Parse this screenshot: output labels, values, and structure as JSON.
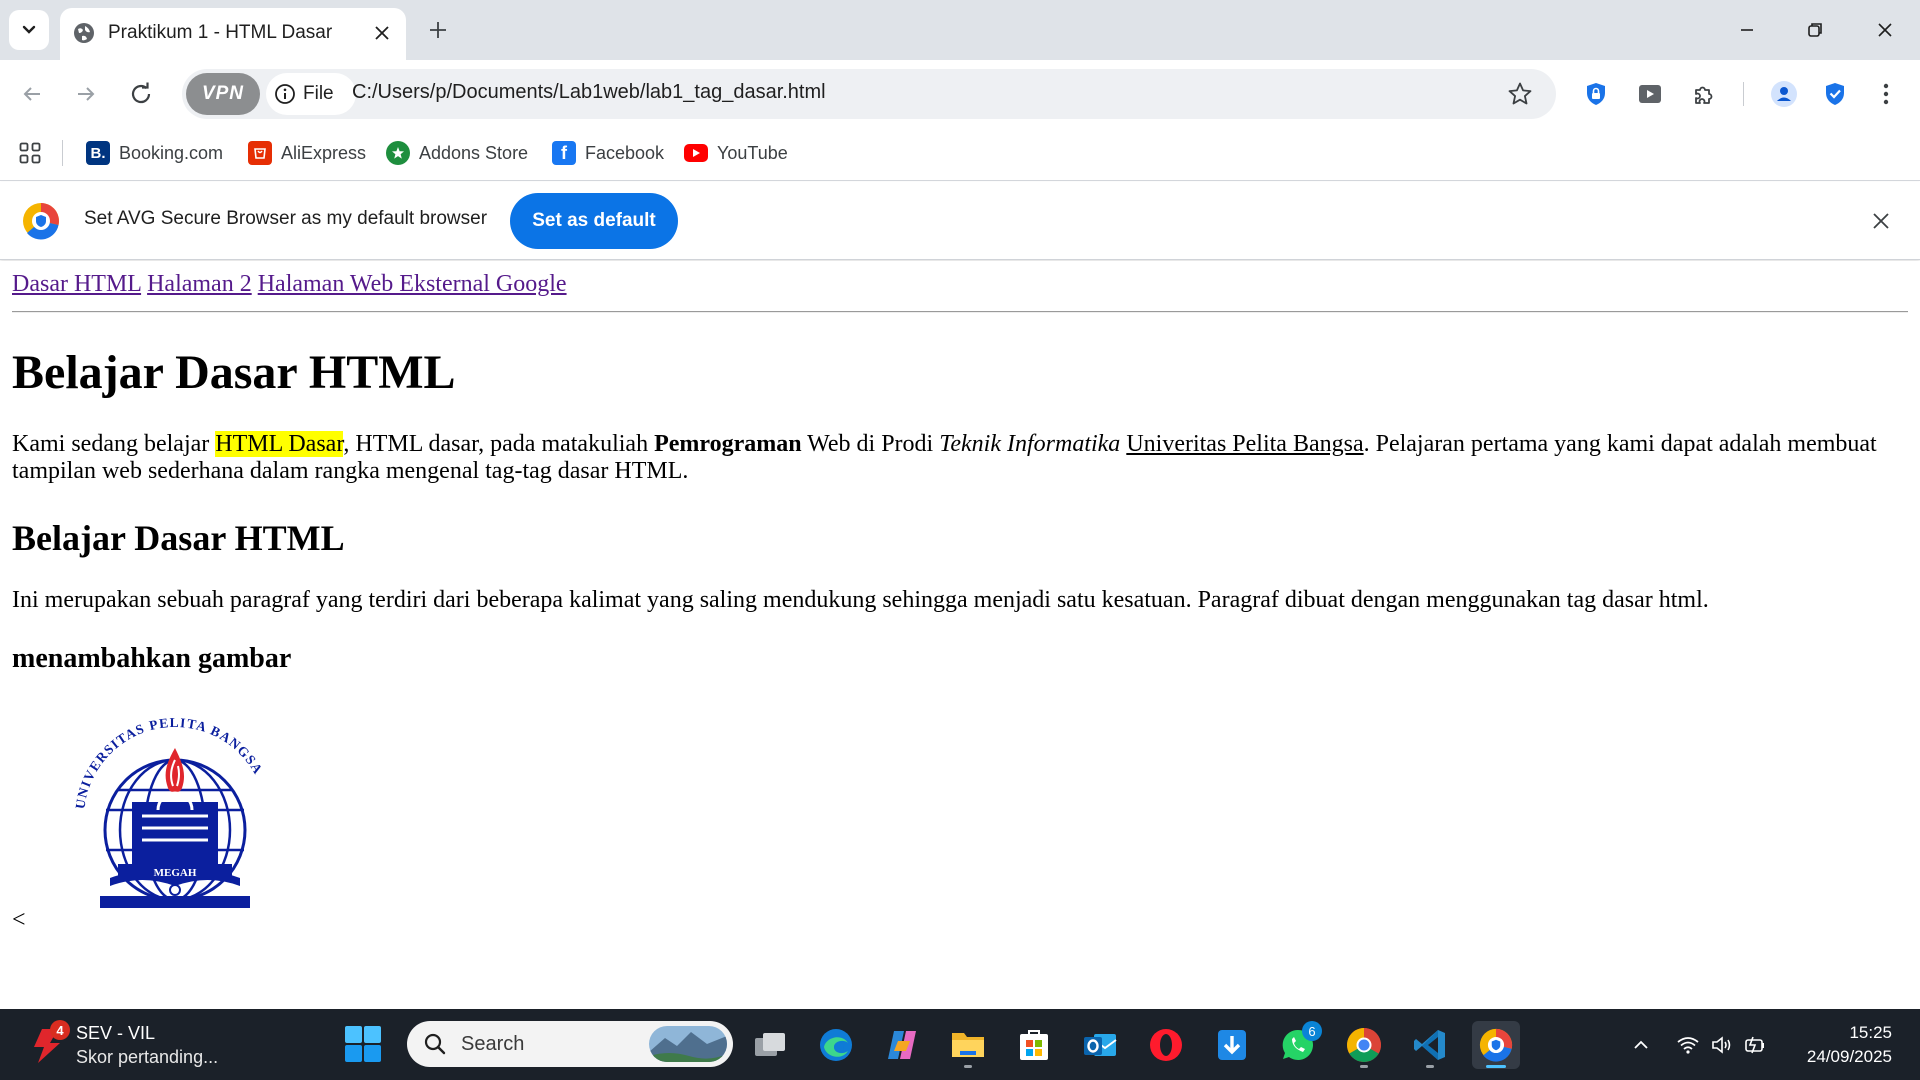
{
  "browser": {
    "tab": {
      "title": "Praktikum 1 - HTML Dasar"
    },
    "omnibox": {
      "vpn_label": "VPN",
      "scheme_label": "File",
      "url": "C:/Users/p/Documents/Lab1web/lab1_tag_dasar.html"
    },
    "bookmarks": [
      {
        "label": "Booking.com",
        "icon": "booking-icon",
        "color": "#003580"
      },
      {
        "label": "AliExpress",
        "icon": "aliexpress-icon",
        "color": "#e62e04"
      },
      {
        "label": "Addons Store",
        "icon": "addons-store-icon",
        "color": "#1e8e3e"
      },
      {
        "label": "Facebook",
        "icon": "facebook-icon",
        "color": "#1877f2"
      },
      {
        "label": "YouTube",
        "icon": "youtube-icon",
        "color": "#ff0000"
      }
    ],
    "infobar": {
      "message": "Set AVG Secure Browser as my default browser",
      "button_label": "Set as default",
      "button_color": "#0b74e6"
    }
  },
  "page": {
    "nav_links": [
      "Dasar HTML",
      "Halaman 2",
      "Halaman Web Eksternal Google"
    ],
    "heading1": "Belajar Dasar HTML",
    "para1": {
      "t1": "Kami sedang belajar ",
      "highlight": "HTML Dasar",
      "t2": ", HTML dasar, pada matakuliah ",
      "bold": "Pemrograman",
      "t3": " Web di Prodi ",
      "italic": "Teknik Informatika",
      "t4": " ",
      "underline": "Univeritas Pelita Bangsa",
      "t5": ". Pelajaran pertama yang kami dapat adalah membuat tampilan web sederhana dalam rangka mengenal tag-tag dasar HTML."
    },
    "heading2": "Belajar Dasar HTML",
    "para2": "Ini merupakan sebuah paragraf yang terdiri dari beberapa kalimat yang saling mendukung sehingga menjadi satu kesatuan. Paragraf dibuat dengan menggunakan tag dasar html.",
    "heading3": "menambahkan gambar",
    "image": {
      "ring_text": "UNIVERSITAS PELITA BANGSA",
      "banner_text": "MEGAH",
      "color": "#0b1f9e"
    },
    "trailing_text": "<"
  },
  "taskbar": {
    "widget": {
      "title": "SEV - VIL",
      "subtitle": "Skor pertanding...",
      "badge": "4"
    },
    "search_placeholder": "Search",
    "whatsapp_badge": "6",
    "clock": {
      "time": "15:25",
      "date": "24/09/2025"
    }
  }
}
